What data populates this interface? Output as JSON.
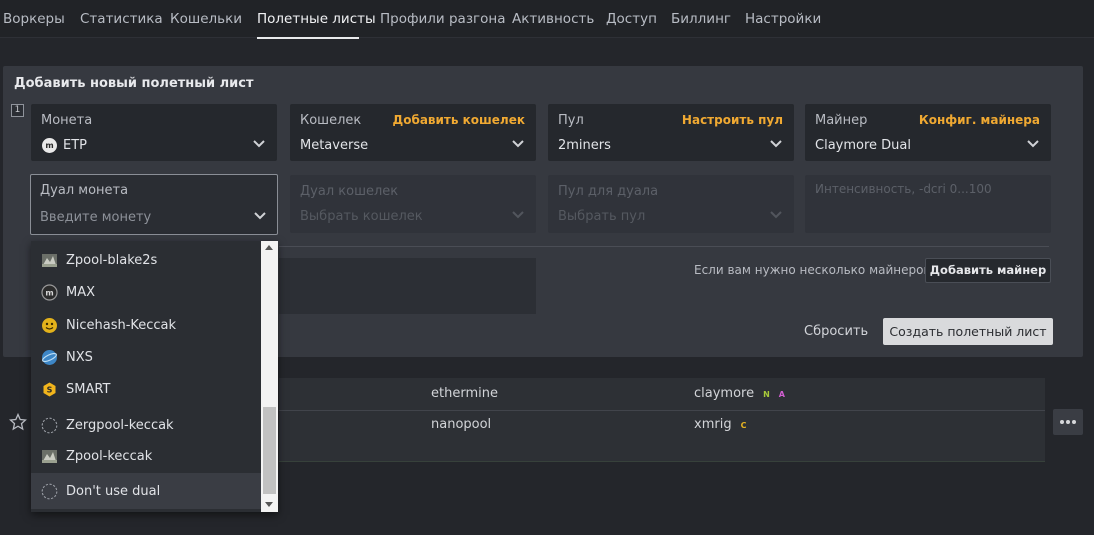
{
  "nav": {
    "items": [
      {
        "label": "Воркеры",
        "active": false
      },
      {
        "label": "Статистика",
        "active": false
      },
      {
        "label": "Кошельки",
        "active": false
      },
      {
        "label": "Полетные листы",
        "active": true
      },
      {
        "label": "Профили разгона",
        "active": false
      },
      {
        "label": "Активность",
        "active": false
      },
      {
        "label": "Доступ",
        "active": false
      },
      {
        "label": "Биллинг",
        "active": false
      },
      {
        "label": "Настройки",
        "active": false
      }
    ]
  },
  "form": {
    "title": "Добавить новый полетный лист",
    "row_number": "1",
    "coin": {
      "label": "Монета",
      "value": "ETP",
      "icon": "metaverse-m-icon"
    },
    "wallet": {
      "label": "Кошелек",
      "link": "Добавить кошелек",
      "value": "Metaverse"
    },
    "pool": {
      "label": "Пул",
      "link": "Настроить пул",
      "value": "2miners"
    },
    "miner": {
      "label": "Майнер",
      "link": "Конфиг. майнера",
      "value": "Claymore Dual"
    },
    "dual_coin": {
      "label": "Дуал монета",
      "placeholder": "Введите монету"
    },
    "dual_wallet": {
      "label": "Дуал кошелек",
      "placeholder": "Выбрать кошелек"
    },
    "dual_pool": {
      "label": "Пул для дуала",
      "placeholder": "Выбрать пул"
    },
    "intensity": {
      "placeholder": "Интенсивность, -dcri 0...100"
    },
    "hint": "Если вам нужно несколько майнеров",
    "add_miner_label": "Добавить майнер",
    "reset_label": "Сбросить",
    "create_label": "Создать полетный лист"
  },
  "dropdown": {
    "options": [
      {
        "label": "Zpool-blake2s",
        "icon": "zpool-icon"
      },
      {
        "label": "MAX",
        "icon": "max-coin-icon"
      },
      {
        "label": "Nicehash-Keccak",
        "icon": "nicehash-icon"
      },
      {
        "label": "NXS",
        "icon": "nexus-icon"
      },
      {
        "label": "SMART",
        "icon": "smartcash-icon"
      },
      {
        "label": "Zergpool-keccak",
        "icon": "dashed-circle-icon"
      },
      {
        "label": "Zpool-keccak",
        "icon": "zpool-icon"
      },
      {
        "label": "Don't use dual",
        "icon": "dashed-circle-icon"
      }
    ]
  },
  "table": {
    "rows": [
      {
        "pool": "ethermine",
        "miner": "claymore",
        "tags": [
          {
            "text": "N",
            "color": "#a7c93a"
          },
          {
            "text": "A",
            "color": "#d25fd2"
          }
        ]
      },
      {
        "pool": "nanopool",
        "miner": "xmrig",
        "tags": [
          {
            "text": "C",
            "color": "#e6b422"
          }
        ]
      }
    ]
  },
  "colors": {
    "accent_link": "#f0a932",
    "primary_button": "#d9dadc",
    "background": "#24262b",
    "panel": "#363940"
  }
}
